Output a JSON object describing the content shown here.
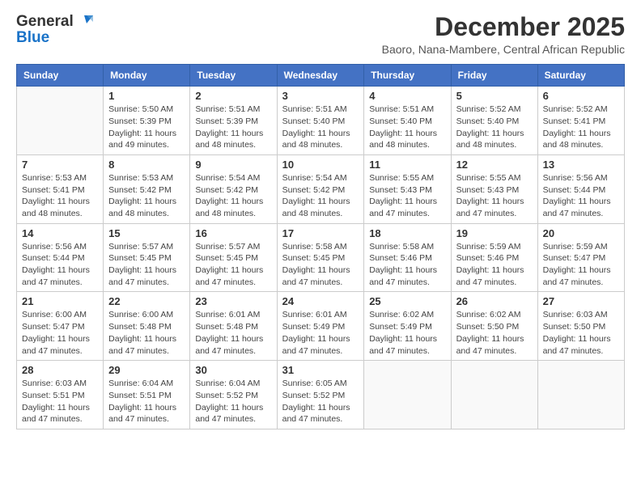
{
  "header": {
    "logo_general": "General",
    "logo_blue": "Blue",
    "month_title": "December 2025",
    "subtitle": "Baoro, Nana-Mambere, Central African Republic"
  },
  "days_of_week": [
    "Sunday",
    "Monday",
    "Tuesday",
    "Wednesday",
    "Thursday",
    "Friday",
    "Saturday"
  ],
  "weeks": [
    [
      {
        "day": "",
        "info": ""
      },
      {
        "day": "1",
        "info": "Sunrise: 5:50 AM\nSunset: 5:39 PM\nDaylight: 11 hours\nand 49 minutes."
      },
      {
        "day": "2",
        "info": "Sunrise: 5:51 AM\nSunset: 5:39 PM\nDaylight: 11 hours\nand 48 minutes."
      },
      {
        "day": "3",
        "info": "Sunrise: 5:51 AM\nSunset: 5:40 PM\nDaylight: 11 hours\nand 48 minutes."
      },
      {
        "day": "4",
        "info": "Sunrise: 5:51 AM\nSunset: 5:40 PM\nDaylight: 11 hours\nand 48 minutes."
      },
      {
        "day": "5",
        "info": "Sunrise: 5:52 AM\nSunset: 5:40 PM\nDaylight: 11 hours\nand 48 minutes."
      },
      {
        "day": "6",
        "info": "Sunrise: 5:52 AM\nSunset: 5:41 PM\nDaylight: 11 hours\nand 48 minutes."
      }
    ],
    [
      {
        "day": "7",
        "info": "Sunrise: 5:53 AM\nSunset: 5:41 PM\nDaylight: 11 hours\nand 48 minutes."
      },
      {
        "day": "8",
        "info": "Sunrise: 5:53 AM\nSunset: 5:42 PM\nDaylight: 11 hours\nand 48 minutes."
      },
      {
        "day": "9",
        "info": "Sunrise: 5:54 AM\nSunset: 5:42 PM\nDaylight: 11 hours\nand 48 minutes."
      },
      {
        "day": "10",
        "info": "Sunrise: 5:54 AM\nSunset: 5:42 PM\nDaylight: 11 hours\nand 48 minutes."
      },
      {
        "day": "11",
        "info": "Sunrise: 5:55 AM\nSunset: 5:43 PM\nDaylight: 11 hours\nand 47 minutes."
      },
      {
        "day": "12",
        "info": "Sunrise: 5:55 AM\nSunset: 5:43 PM\nDaylight: 11 hours\nand 47 minutes."
      },
      {
        "day": "13",
        "info": "Sunrise: 5:56 AM\nSunset: 5:44 PM\nDaylight: 11 hours\nand 47 minutes."
      }
    ],
    [
      {
        "day": "14",
        "info": "Sunrise: 5:56 AM\nSunset: 5:44 PM\nDaylight: 11 hours\nand 47 minutes."
      },
      {
        "day": "15",
        "info": "Sunrise: 5:57 AM\nSunset: 5:45 PM\nDaylight: 11 hours\nand 47 minutes."
      },
      {
        "day": "16",
        "info": "Sunrise: 5:57 AM\nSunset: 5:45 PM\nDaylight: 11 hours\nand 47 minutes."
      },
      {
        "day": "17",
        "info": "Sunrise: 5:58 AM\nSunset: 5:45 PM\nDaylight: 11 hours\nand 47 minutes."
      },
      {
        "day": "18",
        "info": "Sunrise: 5:58 AM\nSunset: 5:46 PM\nDaylight: 11 hours\nand 47 minutes."
      },
      {
        "day": "19",
        "info": "Sunrise: 5:59 AM\nSunset: 5:46 PM\nDaylight: 11 hours\nand 47 minutes."
      },
      {
        "day": "20",
        "info": "Sunrise: 5:59 AM\nSunset: 5:47 PM\nDaylight: 11 hours\nand 47 minutes."
      }
    ],
    [
      {
        "day": "21",
        "info": "Sunrise: 6:00 AM\nSunset: 5:47 PM\nDaylight: 11 hours\nand 47 minutes."
      },
      {
        "day": "22",
        "info": "Sunrise: 6:00 AM\nSunset: 5:48 PM\nDaylight: 11 hours\nand 47 minutes."
      },
      {
        "day": "23",
        "info": "Sunrise: 6:01 AM\nSunset: 5:48 PM\nDaylight: 11 hours\nand 47 minutes."
      },
      {
        "day": "24",
        "info": "Sunrise: 6:01 AM\nSunset: 5:49 PM\nDaylight: 11 hours\nand 47 minutes."
      },
      {
        "day": "25",
        "info": "Sunrise: 6:02 AM\nSunset: 5:49 PM\nDaylight: 11 hours\nand 47 minutes."
      },
      {
        "day": "26",
        "info": "Sunrise: 6:02 AM\nSunset: 5:50 PM\nDaylight: 11 hours\nand 47 minutes."
      },
      {
        "day": "27",
        "info": "Sunrise: 6:03 AM\nSunset: 5:50 PM\nDaylight: 11 hours\nand 47 minutes."
      }
    ],
    [
      {
        "day": "28",
        "info": "Sunrise: 6:03 AM\nSunset: 5:51 PM\nDaylight: 11 hours\nand 47 minutes."
      },
      {
        "day": "29",
        "info": "Sunrise: 6:04 AM\nSunset: 5:51 PM\nDaylight: 11 hours\nand 47 minutes."
      },
      {
        "day": "30",
        "info": "Sunrise: 6:04 AM\nSunset: 5:52 PM\nDaylight: 11 hours\nand 47 minutes."
      },
      {
        "day": "31",
        "info": "Sunrise: 6:05 AM\nSunset: 5:52 PM\nDaylight: 11 hours\nand 47 minutes."
      },
      {
        "day": "",
        "info": ""
      },
      {
        "day": "",
        "info": ""
      },
      {
        "day": "",
        "info": ""
      }
    ]
  ]
}
